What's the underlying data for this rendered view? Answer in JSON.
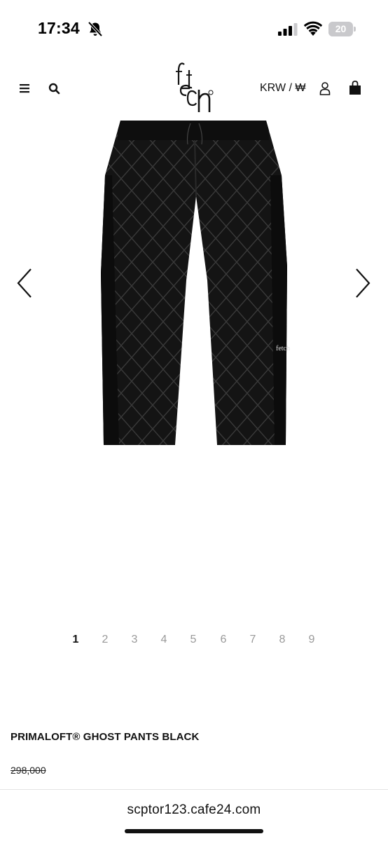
{
  "status_bar": {
    "time": "17:34",
    "battery_level": "20",
    "icons": [
      "bell-slash-icon",
      "cellular-signal-icon",
      "wifi-icon",
      "battery-icon"
    ]
  },
  "header": {
    "logo_icon": "fetch-logo",
    "currency_label": "KRW / ₩",
    "icons": [
      "menu-icon",
      "search-icon",
      "user-icon",
      "shopping-bag-icon"
    ]
  },
  "gallery": {
    "product_image_icon": "quilted-pants-image",
    "prev_icon": "chevron-left-icon",
    "next_icon": "chevron-right-icon",
    "pages": [
      "1",
      "2",
      "3",
      "4",
      "5",
      "6",
      "7",
      "8",
      "9"
    ],
    "current_page": "1"
  },
  "product": {
    "name": "PRIMALOFT® GHOST PANTS BLACK",
    "price": "298,000"
  },
  "browser": {
    "url": "scptor123.cafe24.com"
  },
  "colors": {
    "text": "#111111",
    "muted": "#999999",
    "battery": "#c9c9cc",
    "product": "#111111"
  }
}
